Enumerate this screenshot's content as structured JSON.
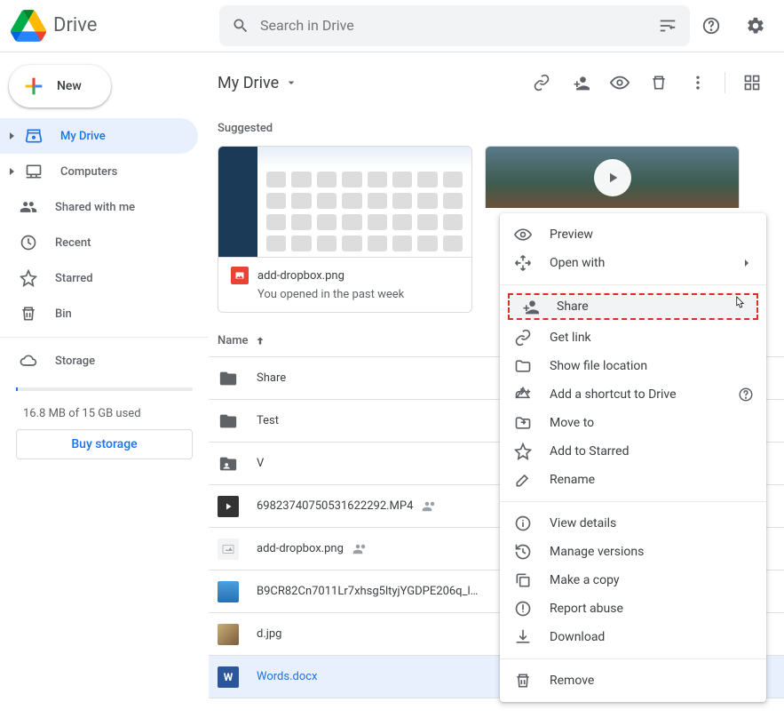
{
  "header": {
    "app_name": "Drive",
    "search_placeholder": "Search in Drive"
  },
  "sidebar": {
    "new_label": "New",
    "items": [
      {
        "label": "My Drive"
      },
      {
        "label": "Computers"
      },
      {
        "label": "Shared with me"
      },
      {
        "label": "Recent"
      },
      {
        "label": "Starred"
      },
      {
        "label": "Bin"
      },
      {
        "label": "Storage"
      }
    ],
    "storage_used": "16.8 MB of 15 GB used",
    "buy_label": "Buy storage"
  },
  "main": {
    "breadcrumb": "My Drive",
    "suggested_label": "Suggested",
    "suggested": [
      {
        "title": "add-dropbox.png",
        "subtitle": "You opened in the past week"
      }
    ],
    "list_header_name": "Name",
    "files": [
      {
        "name": "Share",
        "type": "folder"
      },
      {
        "name": "Test",
        "type": "folder"
      },
      {
        "name": "V",
        "type": "folder_shared"
      },
      {
        "name": "69823740750531622292.MP4",
        "type": "video",
        "shared": true
      },
      {
        "name": "add-dropbox.png",
        "type": "image",
        "shared": true
      },
      {
        "name": "B9CR82Cn7011Lr7xhsg5ltyjYGDPE206q_l…",
        "type": "image_wide"
      },
      {
        "name": "d.jpg",
        "type": "image_thumb"
      },
      {
        "name": "Words.docx",
        "type": "word",
        "selected": true
      }
    ]
  },
  "context_menu": {
    "preview": "Preview",
    "open_with": "Open with",
    "share": "Share",
    "get_link": "Get link",
    "show_location": "Show file location",
    "add_shortcut": "Add a shortcut to Drive",
    "move_to": "Move to",
    "add_starred": "Add to Starred",
    "rename": "Rename",
    "view_details": "View details",
    "manage_versions": "Manage versions",
    "make_copy": "Make a copy",
    "report_abuse": "Report abuse",
    "download": "Download",
    "remove": "Remove"
  }
}
